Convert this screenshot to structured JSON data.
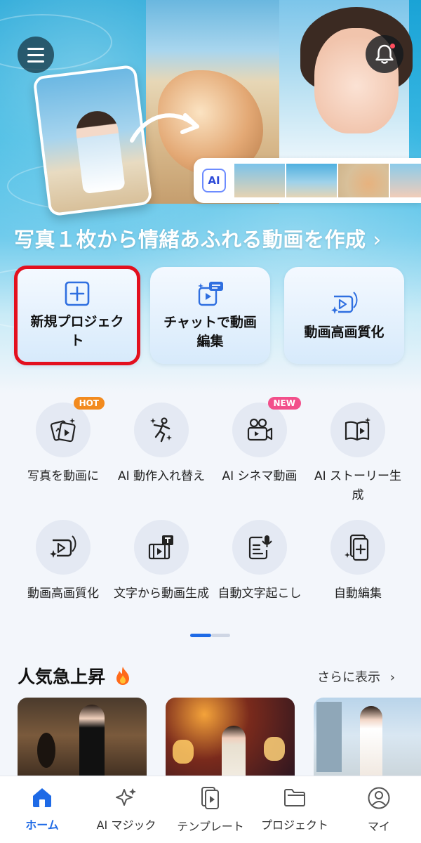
{
  "hero": {
    "title": "写真１枚から情緒あふれる動画を作成",
    "title_chevron": "›",
    "ai_badge": "AI"
  },
  "actions": [
    {
      "label": "新規プロジェクト",
      "icon": "plus-square-icon",
      "selected": true
    },
    {
      "label": "チャットで動画編集",
      "icon": "chat-video-icon"
    },
    {
      "label": "動画高画質化",
      "icon": "video-sparkle-icon"
    }
  ],
  "tools": [
    {
      "label": "写真を動画に",
      "icon": "photo-to-video-icon",
      "badge": "HOT"
    },
    {
      "label": "AI 動作入れ替え",
      "icon": "dance-figure-icon"
    },
    {
      "label": "AI シネマ動画",
      "icon": "movie-camera-icon",
      "badge": "NEW"
    },
    {
      "label": "AI ストーリー生成",
      "icon": "story-book-icon"
    },
    {
      "label": "動画高画質化",
      "icon": "video-sparkle-icon"
    },
    {
      "label": "文字から動画生成",
      "icon": "text-to-video-icon"
    },
    {
      "label": "自動文字起こし",
      "icon": "transcript-mic-icon"
    },
    {
      "label": "自動編集",
      "icon": "auto-edit-icon"
    }
  ],
  "trending": {
    "title": "人気急上昇",
    "title_icon": "fire-icon",
    "more": "さらに表示",
    "more_chevron": "›"
  },
  "nav": [
    {
      "label": "ホーム",
      "icon": "home-icon",
      "active": true
    },
    {
      "label": "AI マジック",
      "icon": "sparkle-icon"
    },
    {
      "label": "テンプレート",
      "icon": "template-icon"
    },
    {
      "label": "プロジェクト",
      "icon": "folder-icon"
    },
    {
      "label": "マイ",
      "icon": "profile-icon"
    }
  ],
  "colors": {
    "accent": "#1e6ae6",
    "selected_border": "#e3101e",
    "hot_badge": "#f28a1e",
    "new_badge": "#f24f8a"
  }
}
